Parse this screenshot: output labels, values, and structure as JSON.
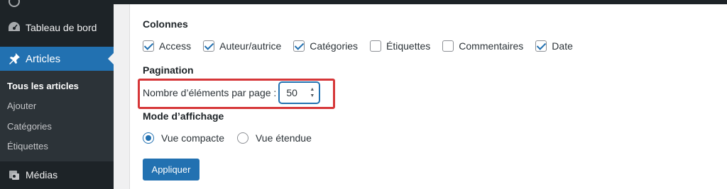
{
  "sidebar": {
    "dashboard_label": "Tableau de bord",
    "articles_label": "Articles",
    "submenu": [
      "Tous les articles",
      "Ajouter",
      "Catégories",
      "Étiquettes"
    ],
    "media_label": "Médias",
    "icons": [
      "dashboard-icon",
      "pin-icon",
      "media-icon"
    ]
  },
  "columns": {
    "title": "Colonnes",
    "items": [
      {
        "label": "Access",
        "checked": true
      },
      {
        "label": "Auteur/autrice",
        "checked": true
      },
      {
        "label": "Catégories",
        "checked": true
      },
      {
        "label": "Étiquettes",
        "checked": false
      },
      {
        "label": "Commentaires",
        "checked": false
      },
      {
        "label": "Date",
        "checked": true
      }
    ]
  },
  "pagination": {
    "title": "Pagination",
    "label": "Nombre d’éléments par page :",
    "value": "50"
  },
  "view_mode": {
    "title": "Mode d’affichage",
    "options": [
      {
        "label": "Vue compacte",
        "selected": true
      },
      {
        "label": "Vue étendue",
        "selected": false
      }
    ]
  },
  "apply_label": "Appliquer",
  "colors": {
    "accent": "#2271b1",
    "highlight": "#d63638",
    "sidebar": "#1d2327"
  }
}
